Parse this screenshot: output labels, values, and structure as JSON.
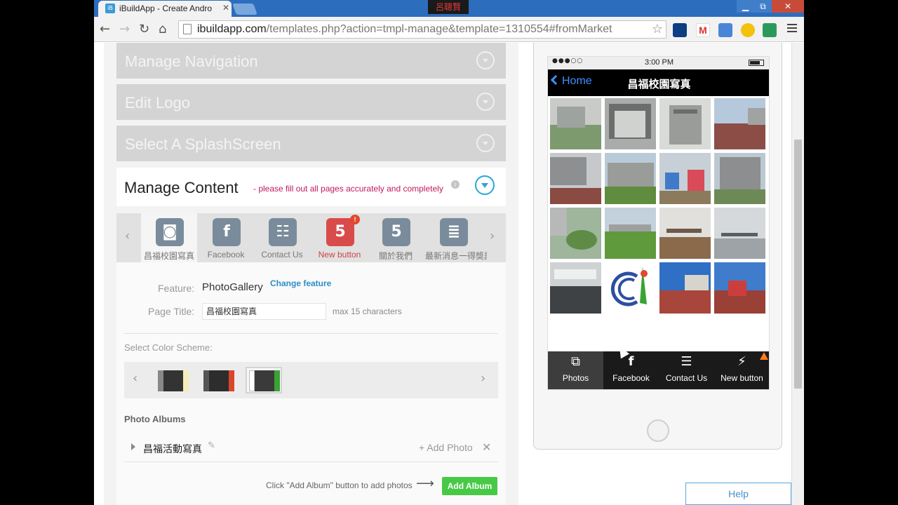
{
  "browser": {
    "tab_title": "iBuildApp - Create Andro",
    "tab_icon": "ibuildapp-icon",
    "user_tag": "呂聰賢",
    "url_host": "ibuildapp.com",
    "url_path": "/templates.php?action=tmpl-manage&template=1310554#fromMarket",
    "ext_badge": "M",
    "window_buttons": {
      "minimize": "▁",
      "maximize": "⧉",
      "close": "✕"
    },
    "nav": {
      "back": "←",
      "forward": "→",
      "reload": "↻",
      "home": "⌂",
      "star": "☆"
    }
  },
  "editor": {
    "sections": [
      {
        "title": "Manage Navigation"
      },
      {
        "title": "Edit Logo"
      },
      {
        "title": "Select A SplashScreen"
      }
    ],
    "manage_content": {
      "title": "Manage Content",
      "hint": "- please fill out all pages accurately and completely",
      "info": "i"
    },
    "feature_tabs": [
      {
        "label": "昌福校園寫真",
        "icon": "camera-icon",
        "glyph": "◙"
      },
      {
        "label": "Facebook",
        "icon": "facebook-icon",
        "glyph": "f"
      },
      {
        "label": "Contact Us",
        "icon": "contact-icon",
        "glyph": "☷"
      },
      {
        "label": "New button",
        "icon": "html5-icon",
        "glyph": "5",
        "badge": "!"
      },
      {
        "label": "關於我們",
        "icon": "html5-icon",
        "glyph": "5"
      },
      {
        "label": "最新消息一得獎記錄",
        "icon": "document-icon",
        "glyph": "≣"
      }
    ],
    "arrows": {
      "prev": "‹",
      "next": "›"
    },
    "form": {
      "feature_label": "Feature:",
      "feature_value": "PhotoGallery",
      "change_feature": "Change feature",
      "page_title_label": "Page Title:",
      "page_title_value": "昌福校園寫真",
      "max_chars": "max 15 characters",
      "color_scheme_label": "Select Color Scheme:"
    },
    "albums": {
      "title": "Photo Albums",
      "items": [
        {
          "name": "昌福活動寫真",
          "add_photo": "+ Add Photo",
          "delete": "✕",
          "edit": "✎"
        }
      ],
      "hint": "Click \"Add Album\" button to add photos",
      "arrow": "⟶",
      "add_album": "Add Album"
    }
  },
  "phone": {
    "status": {
      "signal": "●●●○○",
      "time": "3:00 PM"
    },
    "nav": {
      "back": "Home",
      "title": "昌福校園寫真"
    },
    "tabs": [
      {
        "label": "Photos",
        "icon": "photos-icon",
        "glyph": "⧉"
      },
      {
        "label": "Facebook",
        "icon": "facebook-icon",
        "glyph": "f"
      },
      {
        "label": "Contact Us",
        "icon": "contact-icon",
        "glyph": "☰"
      },
      {
        "label": "New button",
        "icon": "lightning-icon",
        "glyph": "⚡"
      }
    ]
  },
  "help": "Help",
  "colors": {
    "accent": "#2aa6d6",
    "warning_text": "#c2185b",
    "add_album_bg": "#48c946",
    "chrome_blue": "#2c6dbd"
  }
}
